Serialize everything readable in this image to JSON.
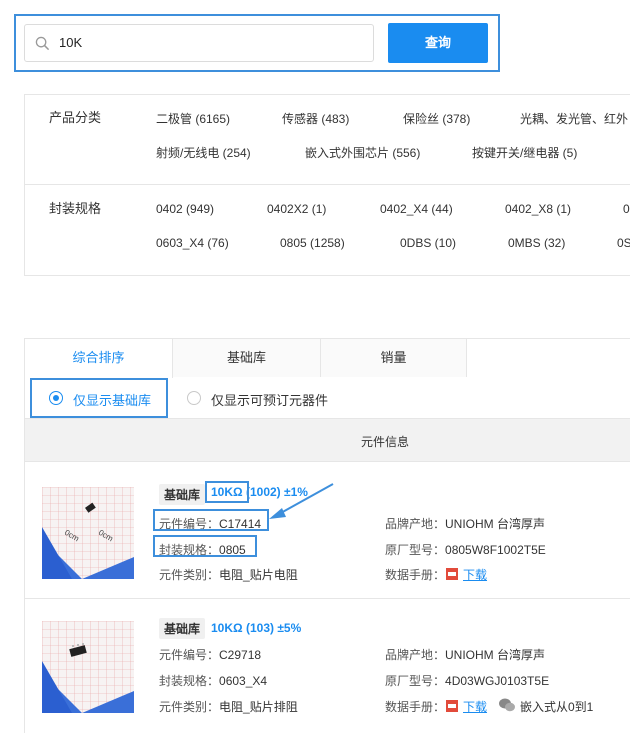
{
  "search": {
    "value": "10K",
    "button_label": "查询"
  },
  "filters": {
    "category": {
      "label": "产品分类",
      "options": [
        "二极管 (6165)",
        "传感器 (483)",
        "保险丝 (378)",
        "光耦、发光管、红外",
        "射频/无线电 (254)",
        "嵌入式外围芯片 (556)",
        "按键开关/继电器 (5)"
      ]
    },
    "package": {
      "label": "封装规格",
      "options": [
        "0402 (949)",
        "0402X2 (1)",
        "0402_X4 (44)",
        "0402_X8 (1)",
        "0",
        "0603_X4 (76)",
        "0805 (1258)",
        "0DBS (10)",
        "0MBS (32)",
        "0S"
      ]
    }
  },
  "tabs": [
    "综合排序",
    "基础库",
    "销量"
  ],
  "radios": [
    "仅显示基础库",
    "仅显示可预订元器件"
  ],
  "table_header": "元件信息",
  "items": [
    {
      "badge": "基础库",
      "name_main": "10KΩ",
      "name_code": " (1002) ",
      "tolerance": "±1%",
      "code_label": "元件编号：",
      "code_value": "C17414",
      "package_label": "封装规格：",
      "package_value": "0805",
      "type_label": "元件类别：",
      "type_value": "电阻_贴片电阻",
      "brand_label": "品牌产地：",
      "brand_value": "UNIOHM 台湾厚声",
      "part_label": "原厂型号：",
      "part_value": "0805W8F1002T5E",
      "datasheet_label": "数据手册：",
      "download_label": "下载"
    },
    {
      "badge": "基础库",
      "name_main": "10KΩ",
      "name_code": " (103) ",
      "tolerance": "±5%",
      "code_label": "元件编号：",
      "code_value": "C29718",
      "package_label": "封装规格：",
      "package_value": "0603_X4",
      "type_label": "元件类别：",
      "type_value": "电阻_贴片排阻",
      "brand_label": "品牌产地：",
      "brand_value": "UNIOHM 台湾厚声",
      "part_label": "原厂型号：",
      "part_value": "4D03WGJ0103T5E",
      "datasheet_label": "数据手册：",
      "download_label": "下载"
    }
  ],
  "thumb_ruler_labels": [
    "0cm",
    "0cm"
  ],
  "watermark": "嵌入式从0到1",
  "colors": {
    "accent": "#1a8cf0",
    "highlight_border": "#3d8fdc"
  }
}
